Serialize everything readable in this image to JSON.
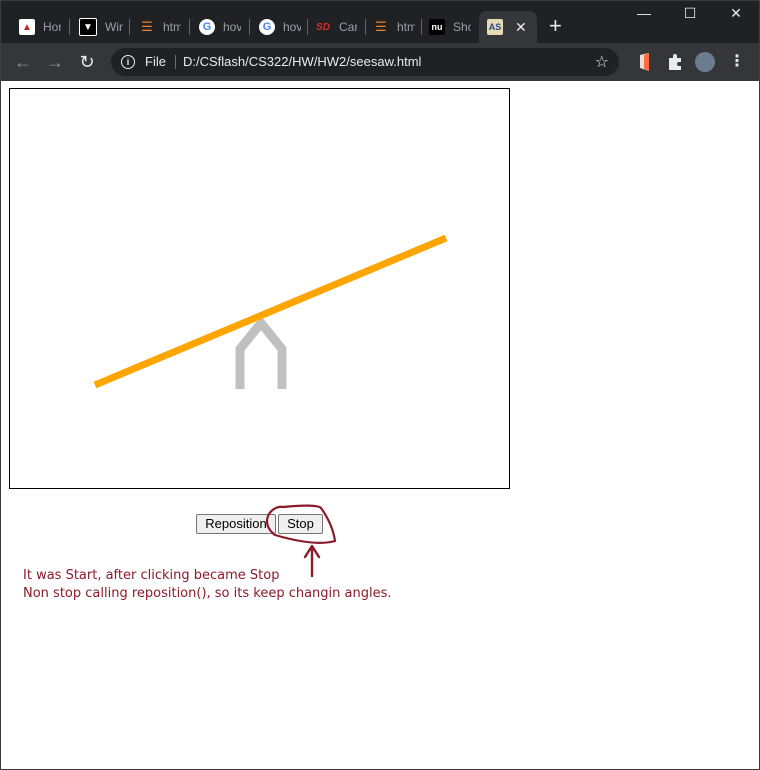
{
  "tabs": [
    {
      "label": "Hor",
      "icon": "red-h-favicon",
      "color": "#c5221f"
    },
    {
      "label": "Wir",
      "icon": "shirt-favicon",
      "color": "#ffffff"
    },
    {
      "label": "htm",
      "icon": "stackoverflow-favicon",
      "color": "#f48024"
    },
    {
      "label": "hov",
      "icon": "google-favicon",
      "color": "#4285f4"
    },
    {
      "label": "hov",
      "icon": "google-favicon",
      "color": "#4285f4"
    },
    {
      "label": "Car",
      "icon": "sd-favicon",
      "color": "#d93025"
    },
    {
      "label": "htm",
      "icon": "stackoverflow-favicon",
      "color": "#f48024"
    },
    {
      "label": "Sho",
      "icon": "nu-favicon",
      "color": "#ffffff"
    }
  ],
  "active_tab": {
    "icon": "as-favicon",
    "glyph": "AS",
    "close": "✕"
  },
  "new_tab": "+",
  "window_controls": {
    "minimize": "—",
    "maximize": "☐",
    "close": "✕"
  },
  "address_bar": {
    "scheme": "File",
    "url": "D:/CSflash/CS322/HW/HW2/seesaw.html"
  },
  "colors": {
    "plank": "#ffa500",
    "fulcrum": "#c0c0c0",
    "annotation": "#8b1a2b"
  },
  "buttons": {
    "reposition": "Reposition",
    "stop": "Stop"
  },
  "notes": {
    "line1": "It was Start, after clicking became Stop",
    "line2": "Non stop calling reposition(), so its keep changin angles."
  }
}
